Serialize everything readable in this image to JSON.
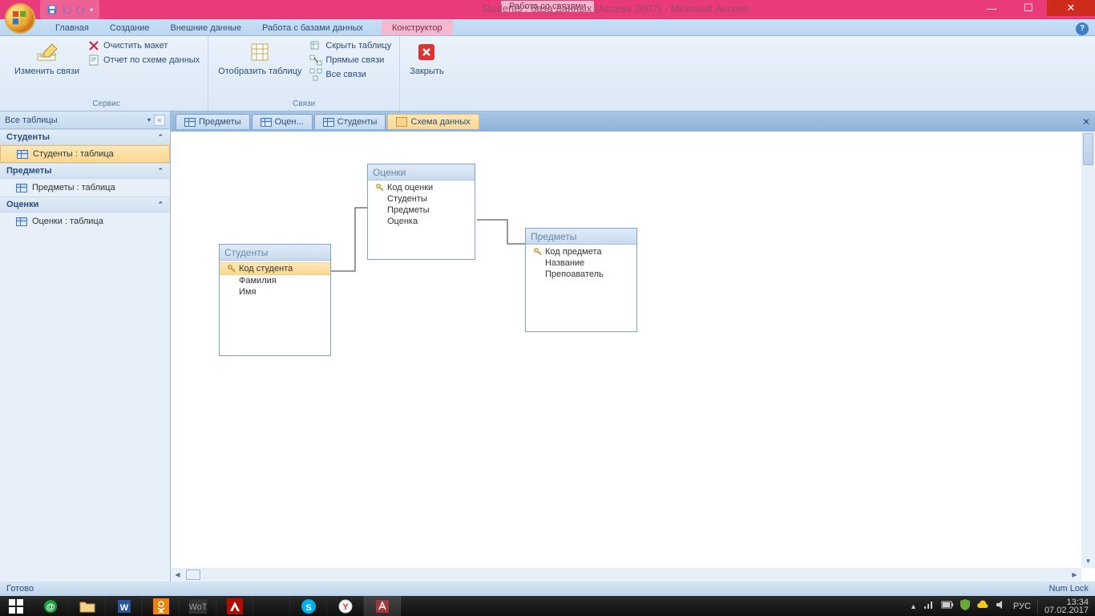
{
  "titlebar": {
    "context": "Работа со связями",
    "app": "Students : база данных (Access 2007) - Microsoft Access"
  },
  "tabs": {
    "t0": "Главная",
    "t1": "Создание",
    "t2": "Внешние данные",
    "t3": "Работа с базами данных",
    "t4": "Конструктор"
  },
  "ribbon": {
    "g1": {
      "big": "Изменить связи",
      "s1": "Очистить макет",
      "s2": "Отчет по схеме данных",
      "label": "Сервис"
    },
    "g2": {
      "big": "Отобразить таблицу",
      "s1": "Скрыть таблицу",
      "s2": "Прямые связи",
      "s3": "Все связи",
      "label": "Связи"
    },
    "g3": {
      "big": "Закрыть"
    }
  },
  "nav": {
    "head": "Все таблицы",
    "g1": "Студенты",
    "i1": "Студенты : таблица",
    "g2": "Предметы",
    "i2": "Предметы : таблица",
    "g3": "Оценки",
    "i3": "Оценки : таблица"
  },
  "doctabs": {
    "t1": "Предметы",
    "t2": "Оцен...",
    "t3": "Студенты",
    "t4": "Схема данных"
  },
  "tables": {
    "students": {
      "title": "Студенты",
      "f1": "Код студента",
      "f2": "Фамилия",
      "f3": "Имя"
    },
    "grades": {
      "title": "Оценки",
      "f1": "Код оценки",
      "f2": "Студенты",
      "f3": "Предметы",
      "f4": "Оценка"
    },
    "subjects": {
      "title": "Предметы",
      "f1": "Код предмета",
      "f2": "Название",
      "f3": "Препоаватель"
    }
  },
  "status": {
    "left": "Готово",
    "right": "Num Lock"
  },
  "taskbar": {
    "lang": "РУС",
    "time": "13:34",
    "date": "07.02.2017"
  }
}
